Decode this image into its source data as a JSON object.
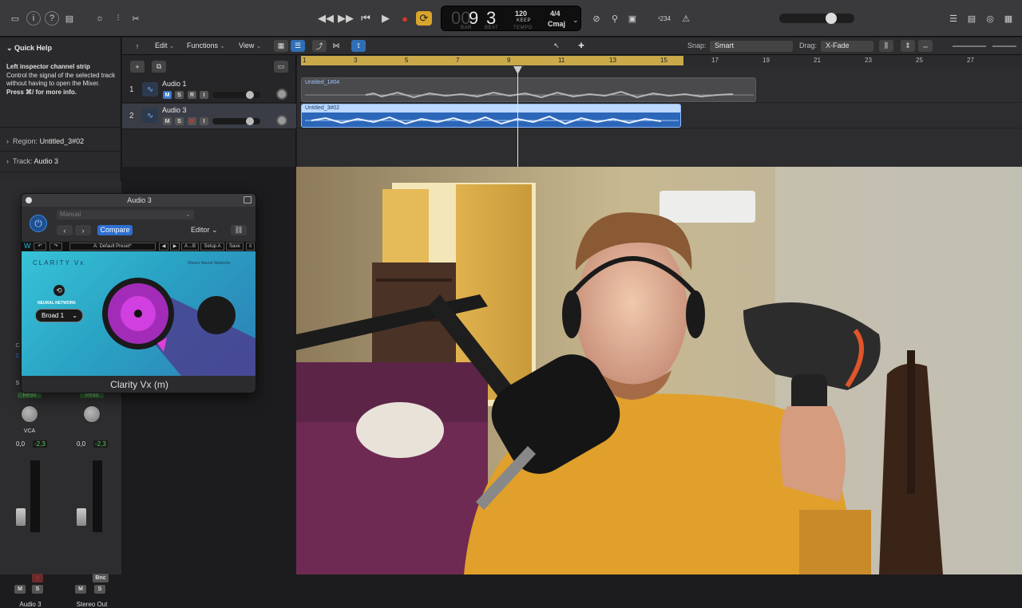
{
  "control_bar": {
    "lcd": {
      "bar": "9",
      "beat": "3",
      "bar_label": "BAR",
      "beat_label": "BEAT",
      "tempo": "120",
      "tempo_mode": "KEEP",
      "tempo_label": "TEMPO",
      "time_sig": "4/4",
      "key": "Cmaj"
    },
    "count_in": "¹234"
  },
  "inspector": {
    "quick_help_title": "Quick Help",
    "quick_help_line1": "Left inspector channel strip",
    "quick_help_body": "Control the signal of the selected track without having to open the Mixer.",
    "quick_help_hint": "Press ⌘/ for more info.",
    "region_label": "Region:",
    "region_value": "Untitled_3#02",
    "track_label": "Track:",
    "track_value": "Audio 3"
  },
  "toolbar": {
    "edit": "Edit",
    "functions": "Functions",
    "view": "View",
    "snap_label": "Snap:",
    "snap_value": "Smart",
    "drag_label": "Drag:",
    "drag_value": "X-Fade"
  },
  "tracks": [
    {
      "number": "1",
      "name": "Audio 1",
      "mute": "M",
      "solo": "S",
      "record": "R",
      "input": "I"
    },
    {
      "number": "2",
      "name": "Audio 3",
      "mute": "M",
      "solo": "S",
      "record": "R",
      "input": "I"
    }
  ],
  "ruler": {
    "bars": [
      "1",
      "3",
      "5",
      "7",
      "9",
      "11",
      "13",
      "15",
      "17",
      "19",
      "21",
      "23",
      "25",
      "27"
    ]
  },
  "regions": [
    {
      "name": "Untitled_1#04"
    },
    {
      "name": "Untitled_3#02"
    }
  ],
  "plugin": {
    "window_title": "Audio 3",
    "preset": "Manual",
    "compare": "Compare",
    "editor": "Editor",
    "waves_preset": "A: Default Preset*",
    "ab": "A→B",
    "setup": "Setup A",
    "save": "Save",
    "product_name": "CLARITY Vx",
    "brand": "Waves Neural Networks",
    "network_label": "NEURAL NETWORK",
    "network_value": "Broad 1",
    "footer_title": "Clarity Vx (m)"
  },
  "mixer": {
    "strip1": {
      "automation": "Read",
      "group": "VCA",
      "volume": "0,0",
      "peak": "-2,3",
      "mute": "M",
      "solo": "S",
      "name": "Audio 3"
    },
    "strip2": {
      "automation": "Read",
      "volume": "0,0",
      "peak": "-2,3",
      "bounce": "Bnc",
      "mute": "M",
      "solo": "S",
      "name": "Stereo Out"
    },
    "side_letters": [
      "C",
      "C",
      "S"
    ]
  },
  "colors": {
    "accent": "#2f6fd0",
    "cycle": "#c9a94a",
    "region_selected": "#2c66b8",
    "record": "#e0322b"
  }
}
